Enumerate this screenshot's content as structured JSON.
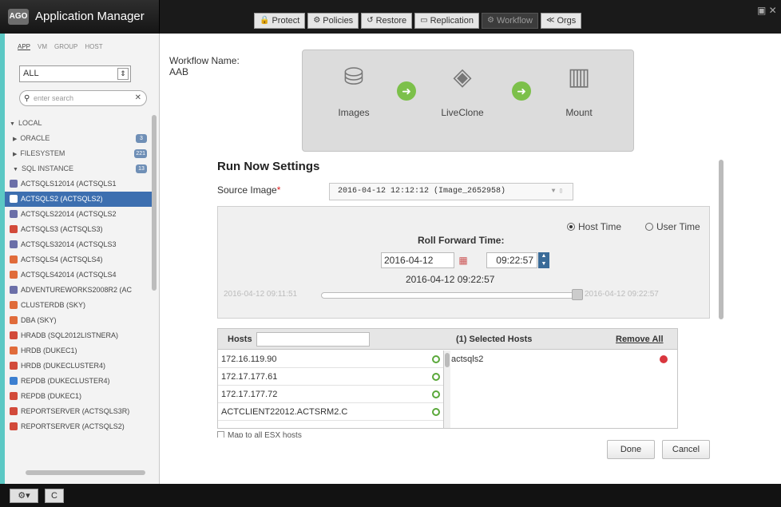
{
  "app": {
    "logo_text": "AGO",
    "title": "Application Manager",
    "window_controls": "▣ ✕"
  },
  "nav": [
    {
      "icon": "lock-icon",
      "glyph": "🔒",
      "label": "Protect"
    },
    {
      "icon": "gear-icon",
      "glyph": "⚙",
      "label": "Policies"
    },
    {
      "icon": "restore-icon",
      "glyph": "↺",
      "label": "Restore"
    },
    {
      "icon": "replication-icon",
      "glyph": "▭",
      "label": "Replication"
    },
    {
      "icon": "workflow-icon",
      "glyph": "⚙",
      "label": "Workflow"
    },
    {
      "icon": "orgs-icon",
      "glyph": "≪",
      "label": "Orgs"
    }
  ],
  "sidebar": {
    "tabs": [
      "APP",
      "VM",
      "GROUP",
      "HOST"
    ],
    "scope_value": "ALL",
    "search_placeholder": "enter search",
    "tree": [
      {
        "label": "LOCAL",
        "kind": "lvl0",
        "caret": "▼"
      },
      {
        "label": "ORACLE",
        "kind": "lvl1",
        "caret": "▶",
        "count": "3"
      },
      {
        "label": "FILESYSTEM",
        "kind": "lvl1",
        "caret": "▶",
        "count": "221"
      },
      {
        "label": "SQL INSTANCE",
        "kind": "lvl1",
        "caret": "▼",
        "count": "13"
      },
      {
        "label": "ACTSQLS12014 (ACTSQLS1",
        "kind": "leaf",
        "icon": "database-icon",
        "color": "#6b6fa8"
      },
      {
        "label": "ACTSQLS2 (ACTSQLS2)",
        "kind": "leaf",
        "icon": "database-icon",
        "color": "#ffffff",
        "selected": true
      },
      {
        "label": "ACTSQLS22014 (ACTSQLS2",
        "kind": "leaf",
        "icon": "database-icon",
        "color": "#6b6fa8"
      },
      {
        "label": "ACTSQLS3 (ACTSQLS3)",
        "kind": "leaf",
        "icon": "blocked-icon",
        "color": "#d24a3a"
      },
      {
        "label": "ACTSQLS32014 (ACTSQLS3",
        "kind": "leaf",
        "icon": "database-icon",
        "color": "#6b6fa8"
      },
      {
        "label": "ACTSQLS4 (ACTSQLS4)",
        "kind": "leaf",
        "icon": "warning-icon",
        "color": "#e06b3a"
      },
      {
        "label": "ACTSQLS42014 (ACTSQLS4",
        "kind": "leaf",
        "icon": "warning-icon",
        "color": "#e06b3a"
      },
      {
        "label": "AdventureWorks2008R2 (AC",
        "kind": "leaf",
        "icon": "database-icon",
        "color": "#6b6fa8"
      },
      {
        "label": "CLUSTERDB (SKY)",
        "kind": "leaf",
        "icon": "warning-icon",
        "color": "#e06b3a"
      },
      {
        "label": "DBA (SKY)",
        "kind": "leaf",
        "icon": "warning-icon",
        "color": "#e06b3a"
      },
      {
        "label": "HRADB (SQL2012LISTNERA)",
        "kind": "leaf",
        "icon": "blocked-icon",
        "color": "#d24a3a"
      },
      {
        "label": "HRDB (DUKEC1)",
        "kind": "leaf",
        "icon": "warning-icon",
        "color": "#e06b3a"
      },
      {
        "label": "HRDB (DUKECLUSTER4)",
        "kind": "leaf",
        "icon": "blocked-icon",
        "color": "#d24a3a"
      },
      {
        "label": "REPDB (DUKECLUSTER4)",
        "kind": "leaf",
        "icon": "shared-db-icon",
        "color": "#3c7fd0"
      },
      {
        "label": "REPDB (DUKEC1)",
        "kind": "leaf",
        "icon": "blocked-icon",
        "color": "#d24a3a"
      },
      {
        "label": "ReportServer (ACTSQLS3R)",
        "kind": "leaf",
        "icon": "blocked-icon",
        "color": "#d24a3a"
      },
      {
        "label": "ReportServer (ACTSQLS2)",
        "kind": "leaf",
        "icon": "blocked-icon",
        "color": "#d24a3a"
      }
    ]
  },
  "bottom": {
    "settings_label": "⚙▾",
    "refresh_label": "C"
  },
  "workflow": {
    "name_label": "Workflow Name:",
    "name_value": "AAB",
    "steps": [
      {
        "label": "Images",
        "icon": "database-stack-icon"
      },
      {
        "label": "LiveClone",
        "icon": "layers-icon"
      },
      {
        "label": "Mount",
        "icon": "server-icon"
      }
    ]
  },
  "run_now": {
    "title": "Run Now Settings",
    "source_label": "Source Image",
    "required_mark": "*",
    "source_value": "2016-04-12 12:12:12 (Image_2652958)",
    "host_time_label": "Host Time",
    "user_time_label": "User Time",
    "roll_forward_title": "Roll Forward Time:",
    "date_value": "2016-04-12",
    "time_value": "09:22:57",
    "roll_forward_value": "2016-04-12 09:22:57",
    "range_min": "2016-04-12 09:11:51",
    "range_max": "2016-04-12 09:22:57",
    "slider_fraction": 1.0
  },
  "hosts": {
    "label": "Hosts",
    "selected_label": "(1) Selected Hosts",
    "remove_all": "Remove All",
    "available": [
      "172.16.119.90",
      "172.17.177.61",
      "172.17.177.72",
      "ACTCLIENT22012.ACTSRM2.C"
    ],
    "selected": [
      "actsqls2"
    ],
    "map_esx": "Map to all ESX hosts"
  },
  "buttons": {
    "done": "Done",
    "cancel": "Cancel"
  }
}
